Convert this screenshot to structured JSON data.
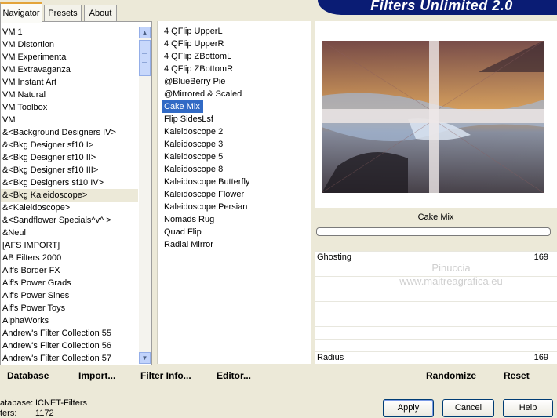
{
  "banner": {
    "title": "Filters Unlimited 2.0"
  },
  "tabs": [
    {
      "label": "Navigator"
    },
    {
      "label": "Presets"
    },
    {
      "label": "About"
    }
  ],
  "categories": [
    "VM 1",
    "VM Distortion",
    "VM Experimental",
    "VM Extravaganza",
    "VM Instant Art",
    "VM Natural",
    "VM Toolbox",
    "VM",
    "&<Background Designers IV>",
    "&<Bkg Designer sf10 I>",
    "&<Bkg Designer sf10 II>",
    "&<Bkg Designer sf10 III>",
    "&<Bkg Designers sf10 IV>",
    "&<Bkg Kaleidoscope>",
    "&<Kaleidoscope>",
    "&<Sandflower Specials^v^ >",
    "&Neul",
    "[AFS IMPORT]",
    "AB Filters 2000",
    "Alf's Border FX",
    "Alf's Power Grads",
    "Alf's Power Sines",
    "Alf's Power Toys",
    "AlphaWorks",
    "Andrew's Filter Collection 55",
    "Andrew's Filter Collection 56",
    "Andrew's Filter Collection 57"
  ],
  "filters": [
    "4 QFlip UpperL",
    "4 QFlip UpperR",
    "4 QFlip ZBottomL",
    "4 QFlip ZBottomR",
    "@BlueBerry Pie",
    "@Mirrored & Scaled",
    "Cake Mix",
    "Flip SidesLsf",
    "Kaleidoscope 2",
    "Kaleidoscope 3",
    "Kaleidoscope 5",
    "Kaleidoscope 8",
    "Kaleidoscope Butterfly",
    "Kaleidoscope Flower",
    "Kaleidoscope Persian",
    "Nomads Rug",
    "Quad Flip",
    "Radial Mirror"
  ],
  "selected_filter": "Cake Mix",
  "params": [
    {
      "label": "Ghosting",
      "value": "169"
    },
    {
      "label": "Radius",
      "value": "169"
    }
  ],
  "watermark": {
    "line1": "Pinuccia",
    "line2": "www.maitreagrafica.eu"
  },
  "left_links": {
    "database": {
      "label": "Database"
    },
    "import": {
      "label": "Import..."
    },
    "filter_info": {
      "label": "Filter Info..."
    },
    "editor": {
      "label": "Editor..."
    }
  },
  "right_links": {
    "randomize": "Randomize",
    "reset": "Reset"
  },
  "info": {
    "database_label": "atabase:",
    "database_value": "ICNET-Filters",
    "filters_label": "ters:",
    "filters_value": "1172"
  },
  "buttons": {
    "apply": "Apply",
    "cancel": "Cancel",
    "help": "Help"
  },
  "colors": {
    "banner": "#0a1c74",
    "selection": "#316ac5",
    "highlight": "#ece9d8"
  }
}
